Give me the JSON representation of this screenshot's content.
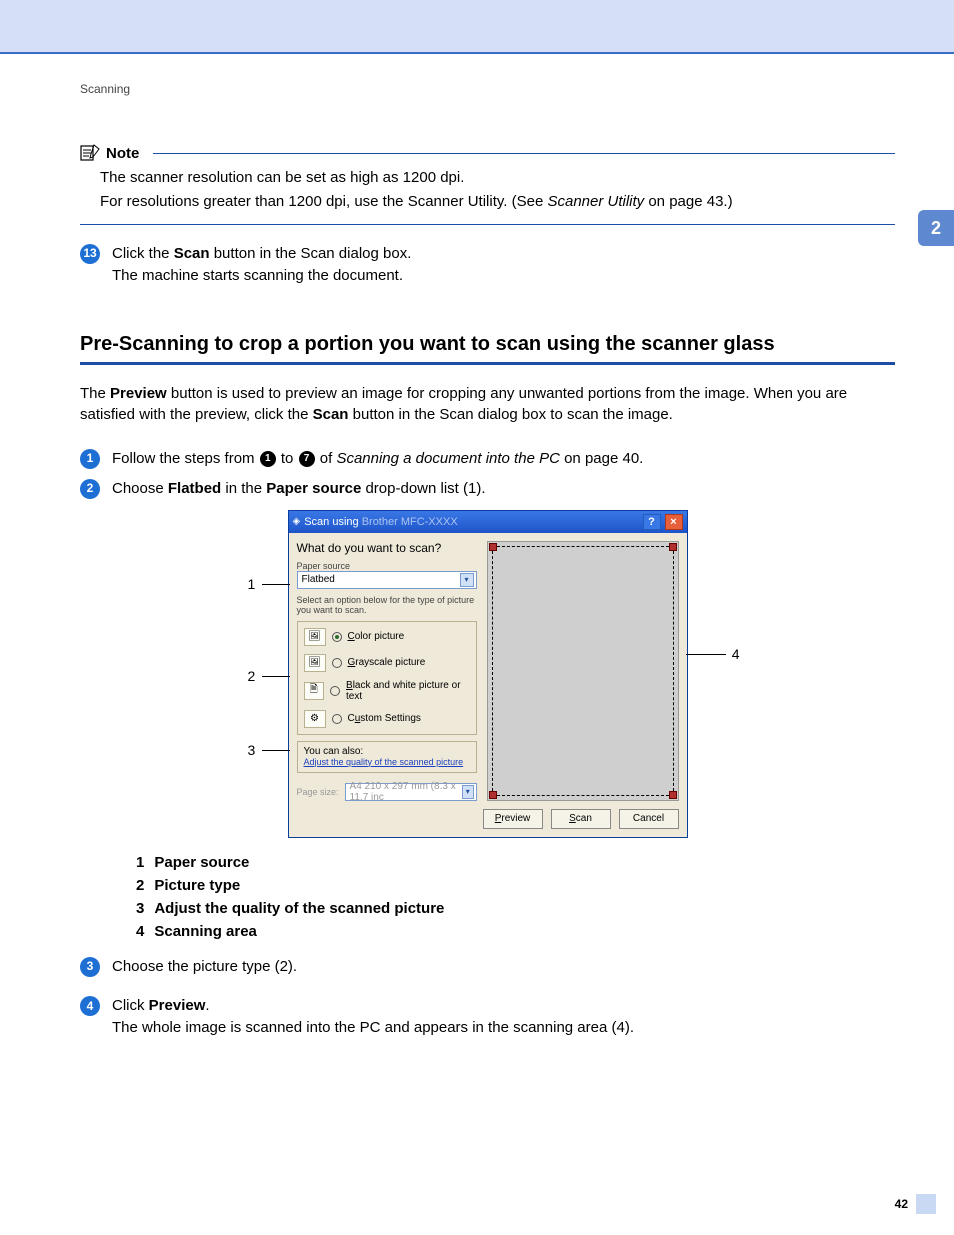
{
  "header": {
    "breadcrumb": "Scanning",
    "chapter_tab": "2",
    "page_number": "42"
  },
  "note": {
    "label": "Note",
    "line1": "The scanner resolution can be set as high as 1200 dpi.",
    "line2_a": "For resolutions greater than 1200 dpi, use the Scanner Utility. (See ",
    "line2_link": "Scanner Utility",
    "line2_b": " on page 43.)"
  },
  "step13": {
    "num": "13",
    "pre": "Click the ",
    "bold": "Scan",
    "post": " button in the Scan dialog box.",
    "line2": "The machine starts scanning the document."
  },
  "section": {
    "title": "Pre-Scanning to crop a portion you want to scan using the scanner glass"
  },
  "intro": {
    "a": "The ",
    "b1": "Preview",
    "c": " button is used to preview an image for cropping any unwanted portions from the image. When you are satisfied with the preview, click the ",
    "b2": "Scan",
    "d": " button in the Scan dialog box to scan the image."
  },
  "step1": {
    "num": "1",
    "a": "Follow the steps from ",
    "inb1": "1",
    "mid": " to ",
    "inb2": "7",
    "b": " of ",
    "link": "Scanning a document into the PC",
    "c": " on page 40."
  },
  "step2": {
    "num": "2",
    "a": "Choose ",
    "b1": "Flatbed",
    "mid": " in the ",
    "b2": "Paper source",
    "c": " drop-down list (1)."
  },
  "dialog": {
    "title": "Scan using ",
    "title_blur": "Brother MFC-XXXX",
    "question": "What do you want to scan?",
    "paper_source_label": "Paper source",
    "paper_source_value": "Flatbed",
    "select_hint": "Select an option below for the type of picture you want to scan.",
    "opt_color": "Color picture",
    "opt_gray": "Grayscale picture",
    "opt_bw": "Black and white picture or text",
    "opt_custom": "Custom Settings",
    "also_label": "You can also:",
    "also_link": "Adjust the quality of the scanned picture",
    "page_size_label": "Page size:",
    "page_size_value": "A4 210 x 297 mm (8.3 x 11.7 inc",
    "btn_preview": "Preview",
    "btn_scan": "Scan",
    "btn_cancel": "Cancel"
  },
  "callouts": {
    "c1": "1",
    "c2": "2",
    "c3": "3",
    "c4": "4"
  },
  "legend": {
    "l1n": "1",
    "l1t": "Paper source",
    "l2n": "2",
    "l2t": "Picture type",
    "l3n": "3",
    "l3t": "Adjust the quality of the scanned picture",
    "l4n": "4",
    "l4t": "Scanning area"
  },
  "step3": {
    "num": "3",
    "text": "Choose the picture type (2)."
  },
  "step4": {
    "num": "4",
    "a": "Click ",
    "b": "Preview",
    "c": ".",
    "line2": "The whole image is scanned into the PC and appears in the scanning area (4)."
  }
}
